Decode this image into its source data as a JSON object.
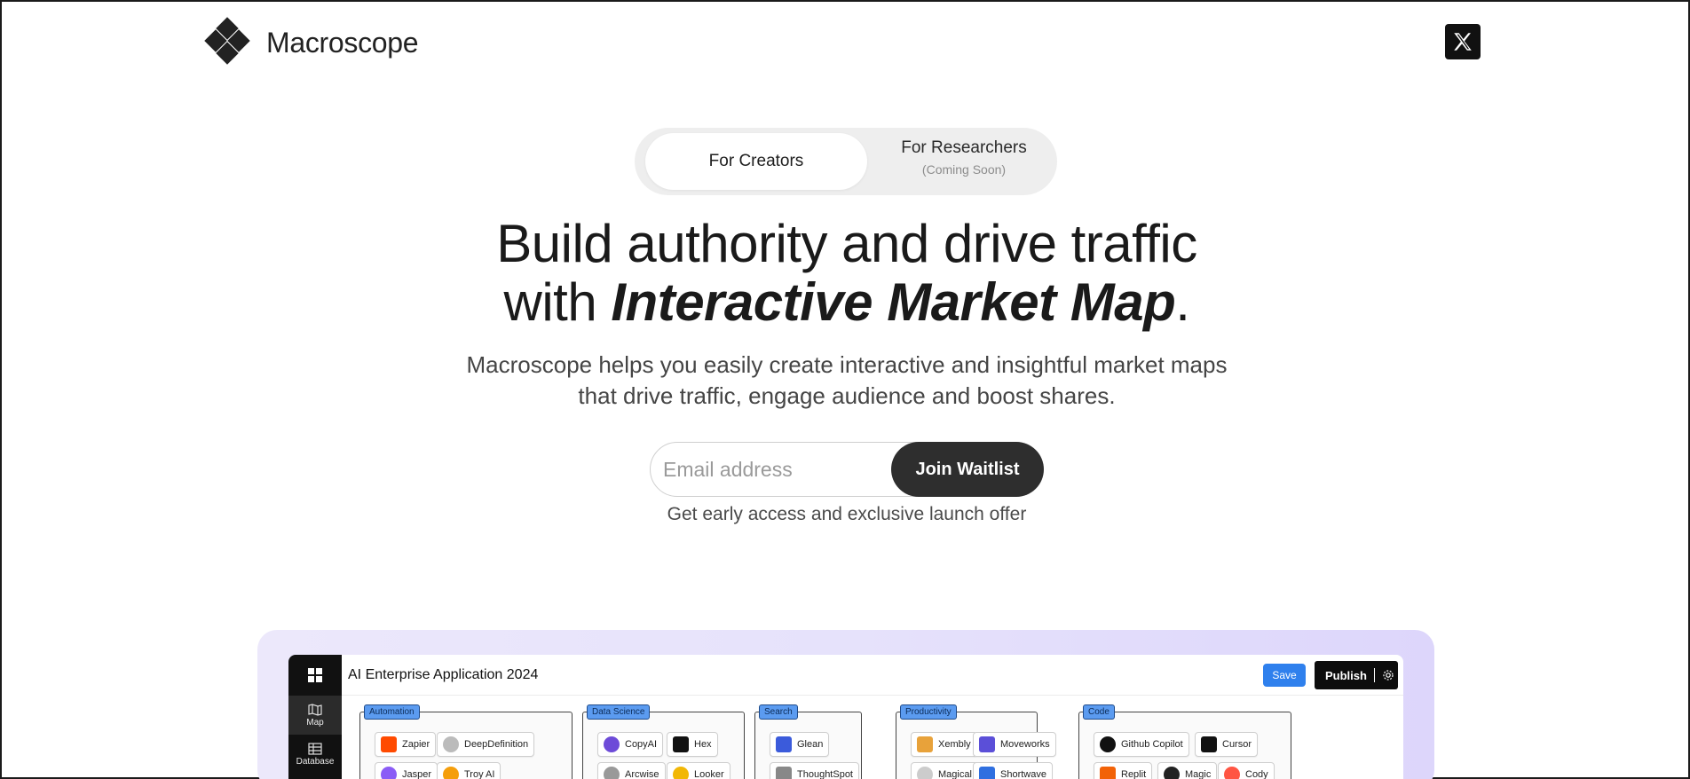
{
  "brand": {
    "name": "Macroscope"
  },
  "header": {
    "x_icon": "x-logo-icon"
  },
  "toggle": {
    "creators_label": "For Creators",
    "researchers_label": "For Researchers",
    "researchers_sub": "(Coming Soon)"
  },
  "hero": {
    "headline_line1": "Build authority and drive traffic",
    "headline_line2_prefix": "with ",
    "headline_line2_emphasis": "Interactive Market Map",
    "headline_line2_suffix": ".",
    "subline_1": "Macroscope helps you easily create interactive and insightful market maps",
    "subline_2": "that drive traffic, engage audience and boost shares."
  },
  "waitlist": {
    "email_placeholder": "Email address",
    "join_label": "Join Waitlist",
    "note": "Get early access and exclusive launch offer"
  },
  "preview": {
    "title": "AI Enterprise Application 2024",
    "save_label": "Save",
    "publish_label": "Publish",
    "sidebar": [
      {
        "label": "Map",
        "icon": "map-icon"
      },
      {
        "label": "Database",
        "icon": "database-icon"
      }
    ],
    "categories": [
      {
        "name": "Automation",
        "chips": [
          "Zapier",
          "DeepDefinition",
          "Jasper",
          "Troy AI"
        ]
      },
      {
        "name": "Data Science",
        "chips": [
          "CopyAI",
          "Hex",
          "Arcwise",
          "Looker"
        ]
      },
      {
        "name": "Search",
        "chips": [
          "Glean",
          "ThoughtSpot"
        ]
      },
      {
        "name": "Productivity",
        "chips": [
          "Xembly",
          "Moveworks",
          "Magical",
          "Shortwave"
        ]
      },
      {
        "name": "Code",
        "chips": [
          "Github Copilot",
          "Cursor",
          "Replit",
          "Magic",
          "Cody"
        ]
      }
    ]
  }
}
